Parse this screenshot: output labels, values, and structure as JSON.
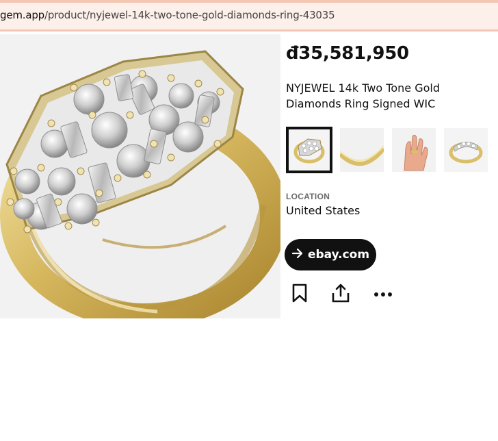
{
  "browser": {
    "url_host": "gem.app",
    "url_path": "/product/nyjewel-14k-two-tone-gold-diamonds-ring-43035"
  },
  "product": {
    "price": "đ35,581,950",
    "title": "NYJEWEL 14k Two Tone Gold Diamonds Ring Signed WIC",
    "location_label": "LOCATION",
    "location_value": "United States"
  },
  "thumbnails": [
    {
      "subject": "ring top view",
      "selected": true
    },
    {
      "subject": "ring band inside"
    },
    {
      "subject": "ring on hand"
    },
    {
      "subject": "ring side view"
    }
  ],
  "actions": {
    "source_button_label": "ebay.com",
    "source_button_icon": "arrow-right-icon",
    "save_icon": "bookmark-icon",
    "share_icon": "share-icon",
    "more_icon": "more-icon"
  },
  "colors": {
    "url_bar_bg": "#fdf0ea",
    "url_bar_border": "#f3c7b3",
    "button_bg": "#111111",
    "gold": "#d9bf6a"
  }
}
